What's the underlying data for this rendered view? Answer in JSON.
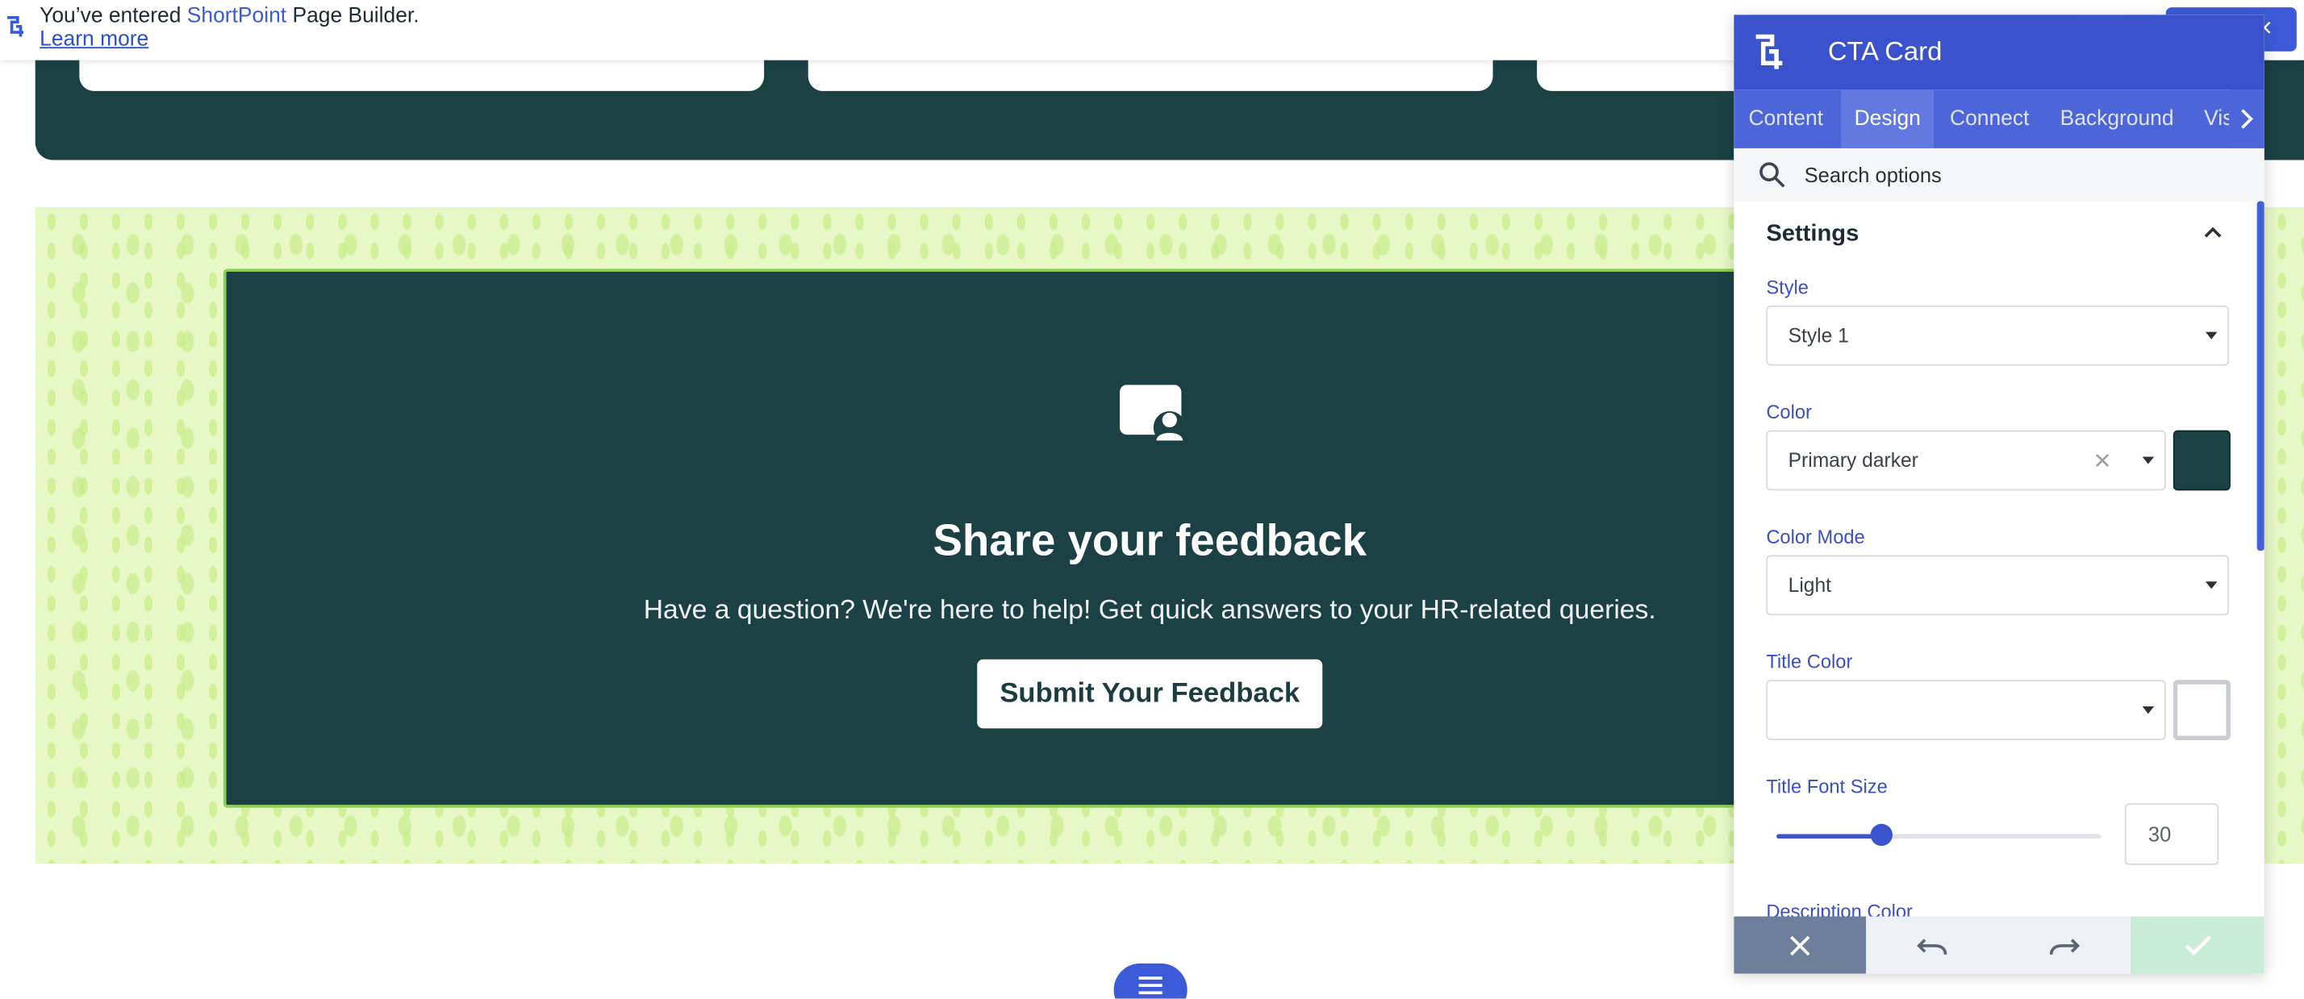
{
  "notice": {
    "prefix": "You’ve entered ",
    "brand": "ShortPoint",
    "suffix": " Page Builder.",
    "learn_more": "Learn more",
    "close_glyph": "✕"
  },
  "cta": {
    "title": "Share your feedback",
    "description": "Have a question? We're here to help! Get quick answers to your HR-related queries.",
    "button_label": "Submit Your Feedback",
    "icon": "chat-user-icon",
    "background": "#1b4145"
  },
  "panel": {
    "title": "CTA Card",
    "tabs": [
      {
        "label": "Content",
        "active": false
      },
      {
        "label": "Design",
        "active": true
      },
      {
        "label": "Connect",
        "active": false
      },
      {
        "label": "Background",
        "active": false
      },
      {
        "label": "Vis",
        "active": false
      }
    ],
    "search": {
      "placeholder": "Search options"
    },
    "section": {
      "title": "Settings"
    },
    "fields": {
      "style": {
        "label": "Style",
        "value": "Style 1"
      },
      "color": {
        "label": "Color",
        "value": "Primary darker",
        "swatch": "#1b4145"
      },
      "color_mode": {
        "label": "Color Mode",
        "value": "Light"
      },
      "title_color": {
        "label": "Title Color",
        "value": "",
        "swatch": "#ffffff"
      },
      "title_font_size": {
        "label": "Title Font Size",
        "value": "30",
        "slider_fraction": 0.32
      },
      "description_color": {
        "label": "Description Color"
      }
    },
    "footer": {
      "cancel_color": "#6e7f9c",
      "undo_color": "#eef0f4",
      "redo_color": "#eef0f4",
      "confirm_color": "#c9ecd9"
    }
  },
  "colors": {
    "accent": "#3a52cc",
    "pattern_bg": "#e7f8c6"
  }
}
